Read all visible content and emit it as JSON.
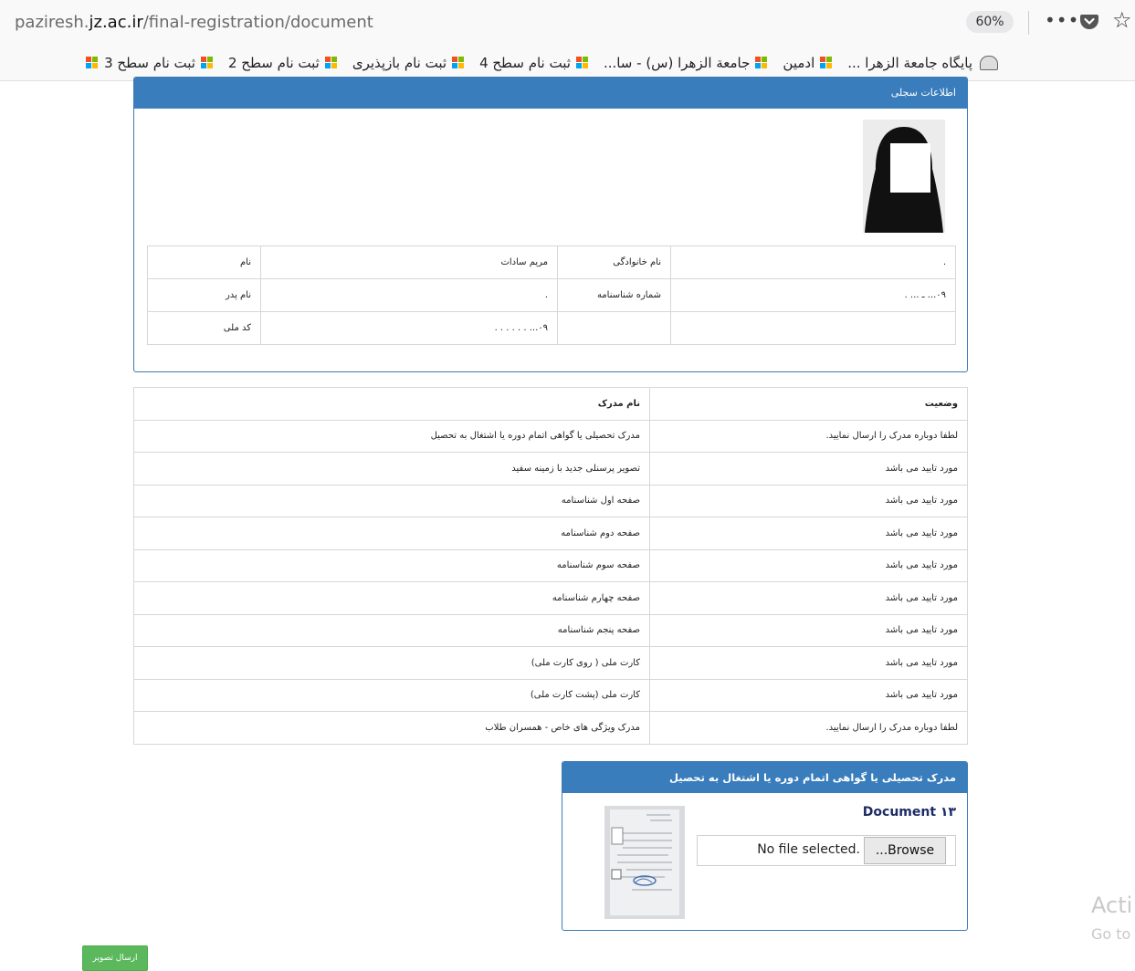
{
  "browser": {
    "url_prefix": "paziresh.",
    "url_domain": "jz.ac.ir",
    "url_path": "/final-registration/document",
    "zoom": "60%",
    "menu_dots": "•••",
    "star": "☆"
  },
  "bookmarks": [
    {
      "label": "پایگاه جامعة الزهرا ...",
      "icon": "dome-icon"
    },
    {
      "label": "ادمین",
      "icon": "ms-icon"
    },
    {
      "label": "جامعة الزهرا (س) - سا...",
      "icon": "ms-icon"
    },
    {
      "label": "ثبت نام سطح 4",
      "icon": "ms-icon"
    },
    {
      "label": "ثبت نام بازپذیری",
      "icon": "ms-icon"
    },
    {
      "label": "ثبت نام سطح 2",
      "icon": "ms-icon"
    },
    {
      "label": "ثبت نام سطح 3",
      "icon": "ms-icon"
    }
  ],
  "profile": {
    "title": "اطلاعات سجلی",
    "rows": [
      [
        "نام",
        "مریم سادات",
        "نام خانوادگی",
        "."
      ],
      [
        "نام پدر",
        ".",
        "شماره شناسنامه",
        "۰۹... ـ ... ."
      ],
      [
        "کد ملی",
        "۰۹... . . . . . .",
        "",
        ""
      ]
    ]
  },
  "documents": {
    "headers": [
      "نام مدرک",
      "وضعیت"
    ],
    "rows": [
      [
        "مدرک تحصیلی یا گواهی اتمام دوره یا اشتغال به تحصیل",
        "لطفا دوباره مدرک را ارسال نمایید."
      ],
      [
        "تصویر پرسنلی جدید با زمینه سفید",
        "مورد تایید می باشد"
      ],
      [
        "صفحه اول شناسنامه",
        "مورد تایید می باشد"
      ],
      [
        "صفحه دوم شناسنامه",
        "مورد تایید می باشد"
      ],
      [
        "صفحه سوم شناسنامه",
        "مورد تایید می باشد"
      ],
      [
        "صفحه چهارم شناسنامه",
        "مورد تایید می باشد"
      ],
      [
        "صفحه پنجم شناسنامه",
        "مورد تایید می باشد"
      ],
      [
        "کارت ملی ( روی کارت ملی)",
        "مورد تایید می باشد"
      ],
      [
        "کارت ملی (پشت کارت ملی)",
        "مورد تایید می باشد"
      ],
      [
        "مدرک ویژگی های خاص - همسران طلاب",
        "لطفا دوباره مدرک را ارسال نمایید."
      ]
    ]
  },
  "upload": {
    "title": "مدرک تحصیلی یا گواهی اتمام دوره یا اشتغال به تحصیل",
    "doc_label": "Document ۱۳",
    "browse_label": "...Browse",
    "file_status": "No file selected."
  },
  "send_button": "ارسال تصویر",
  "watermark": {
    "line1": "Acti",
    "line2": "Go to"
  }
}
